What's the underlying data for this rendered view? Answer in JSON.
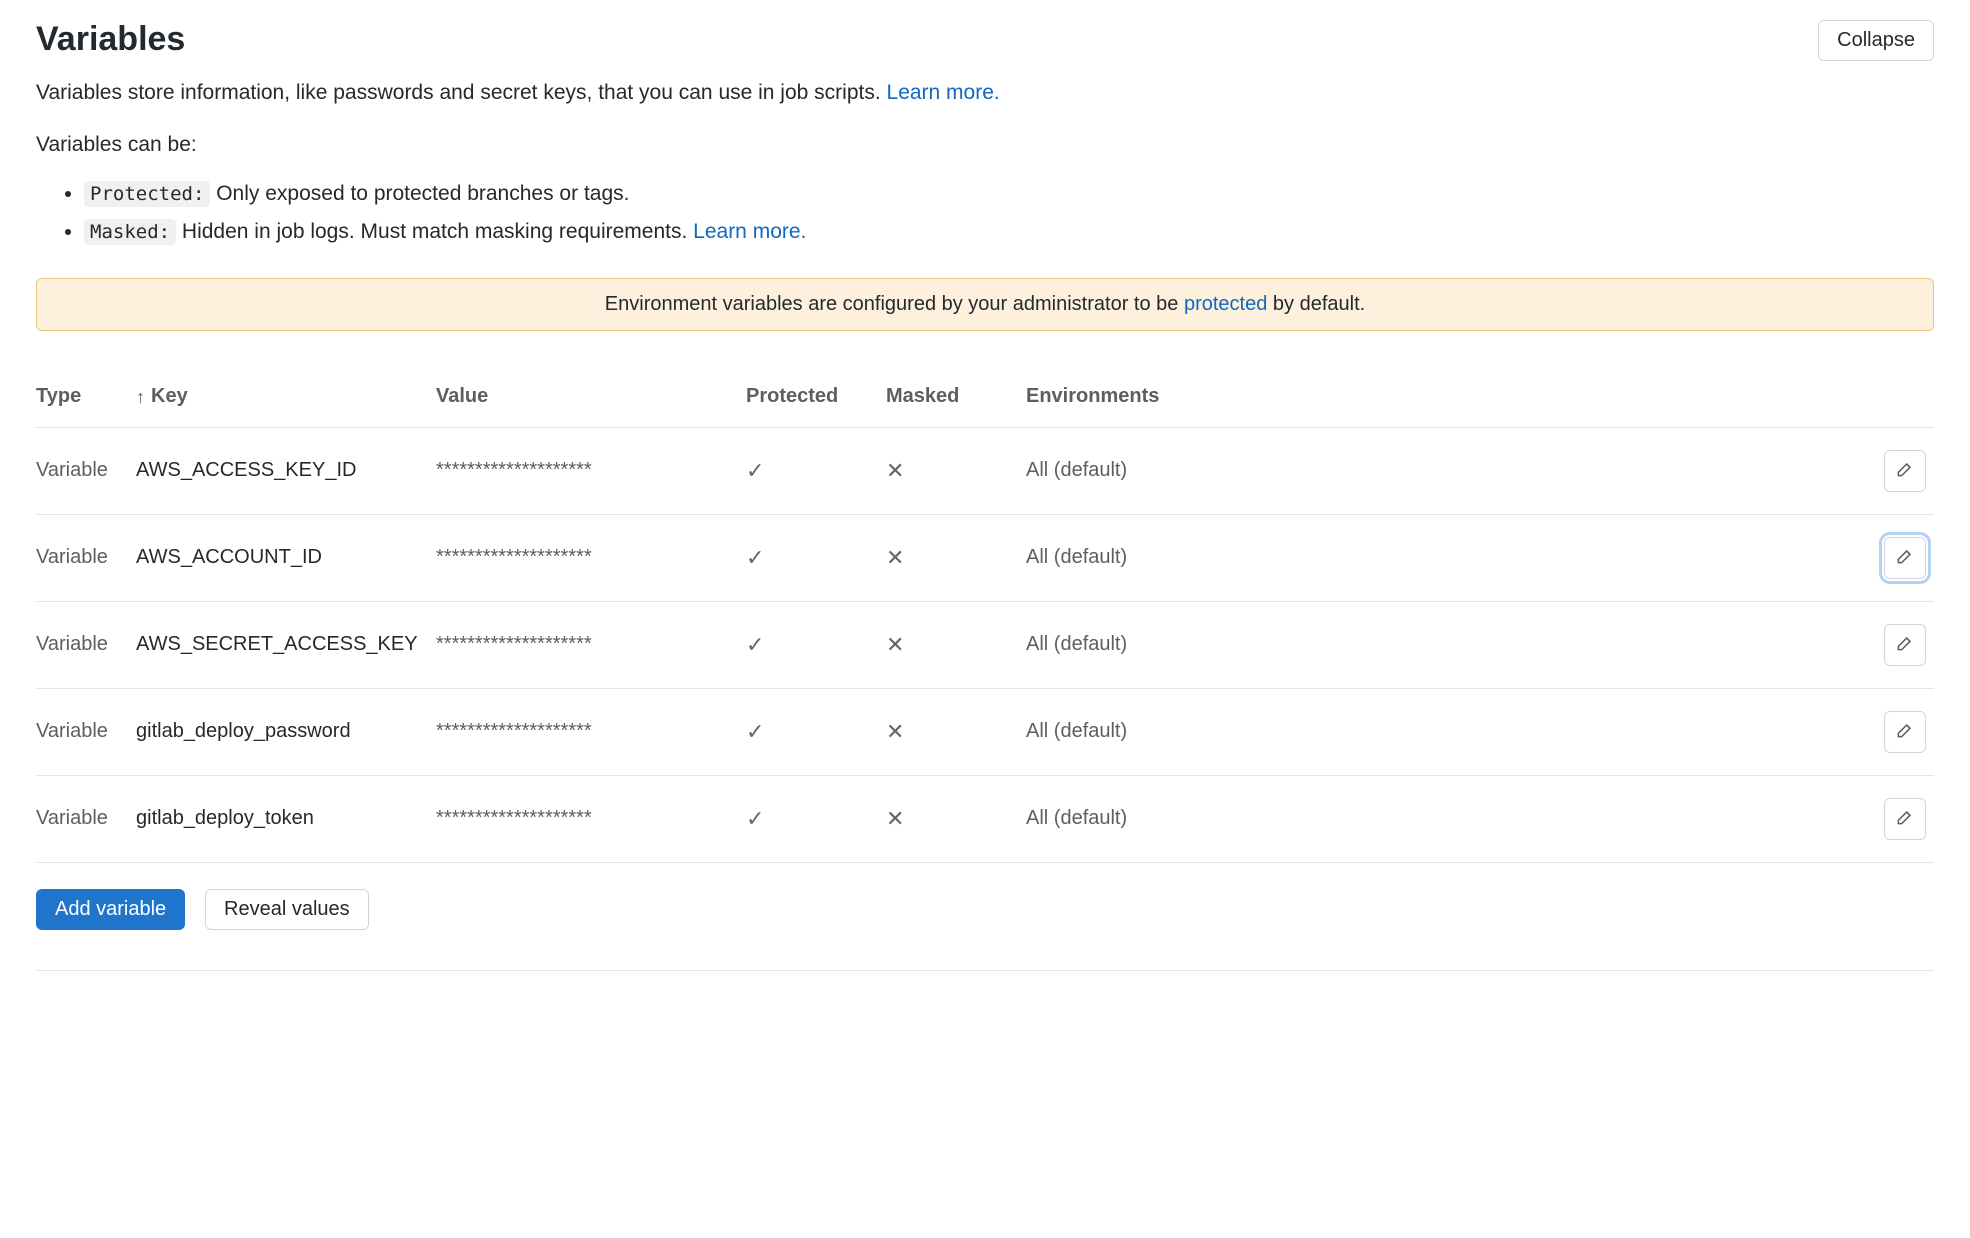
{
  "section": {
    "title": "Variables",
    "collapse": "Collapse",
    "lead_before": "Variables store information, like passwords and secret keys, that you can use in job scripts. ",
    "lead_link": "Learn more.",
    "can_be": "Variables can be:",
    "bullets": {
      "protected_tag": "Protected:",
      "protected_text": " Only exposed to protected branches or tags.",
      "masked_tag": "Masked:",
      "masked_text": " Hidden in job logs. Must match masking requirements. ",
      "masked_link": "Learn more."
    },
    "alert_before": "Environment variables are configured by your administrator to be ",
    "alert_link": "protected",
    "alert_after": " by default."
  },
  "table": {
    "headers": {
      "type": "Type",
      "key": "Key",
      "value": "Value",
      "protected": "Protected",
      "masked": "Masked",
      "env": "Environments"
    },
    "sort_indicator": "↑",
    "rows": [
      {
        "type": "Variable",
        "key": "AWS_ACCESS_KEY_ID",
        "value": "********************",
        "protected": true,
        "masked": false,
        "env": "All (default)",
        "focused": false
      },
      {
        "type": "Variable",
        "key": "AWS_ACCOUNT_ID",
        "value": "********************",
        "protected": true,
        "masked": false,
        "env": "All (default)",
        "focused": true
      },
      {
        "type": "Variable",
        "key": "AWS_SECRET_ACCESS_KEY",
        "value": "********************",
        "protected": true,
        "masked": false,
        "env": "All (default)",
        "focused": false
      },
      {
        "type": "Variable",
        "key": "gitlab_deploy_password",
        "value": "********************",
        "protected": true,
        "masked": false,
        "env": "All (default)",
        "focused": false
      },
      {
        "type": "Variable",
        "key": "gitlab_deploy_token",
        "value": "********************",
        "protected": true,
        "masked": false,
        "env": "All (default)",
        "focused": false
      }
    ]
  },
  "actions": {
    "add": "Add variable",
    "reveal": "Reveal values"
  },
  "glyphs": {
    "check": "✓",
    "cross": "✕"
  }
}
